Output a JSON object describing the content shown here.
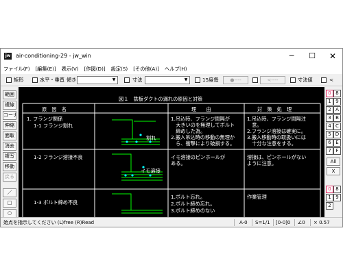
{
  "window": {
    "app_icon": "jw",
    "title": "air-conditioning-29 - jw_win",
    "controls": {
      "minimize": "─",
      "maximize": "☐",
      "close": "✕"
    }
  },
  "menu": [
    "ファイル(F)",
    "[編集(E)]",
    "表示(V)",
    "[作図(D)]",
    "設定(S)",
    "[その他(A)]",
    "ヘルプ(H)"
  ],
  "toolbar": {
    "rect_label": "矩形",
    "hv_label": "水平・垂直",
    "tilt_label": "傾き",
    "tilt_value": "",
    "dim_label": "寸法",
    "dim_value": "",
    "deg15_label": "15度毎",
    "btn_circle": "●----",
    "btn_arrow": "<----",
    "dimvalue_label": "寸法値",
    "lt_label": "<"
  },
  "left_tools": [
    "範囲",
    "複線",
    "コーナー",
    "伸縮",
    "面取",
    "消去",
    "複写",
    "移動",
    "戻る",
    "／",
    "□",
    "○"
  ],
  "right_panel": {
    "layers_top": [
      "0",
      "8",
      "1",
      "9",
      "2",
      "A",
      "3",
      "B",
      "4",
      "C",
      "5",
      "D",
      "6",
      "E",
      "7",
      "F"
    ],
    "all_label": "All",
    "ex_label": "X",
    "layers_bottom": [
      "0",
      "8",
      "1",
      "9",
      "2"
    ]
  },
  "drawing": {
    "figure_title": "図１　鉄板ダクトの漏れの原因と対策",
    "headers": [
      "原　因　名",
      "理　　由",
      "対　策　処　理"
    ],
    "rows": [
      {
        "cause_main": "1. フランジ関係",
        "cause_sub": "1-1 フランジ割れ",
        "diagram_label": "割れ",
        "reason": [
          "1.吊込時、フランジ間隔が",
          "　大きいのを無理してボルト",
          "　締めした為。",
          "2.搬入吊込時の移動の無理か",
          "　ら、衝撃により破損する。"
        ],
        "measure": [
          "1.吊込時、フランジ間隔注",
          "　意。",
          "2.フランジ溶接は確実に。",
          "3.搬入移動時の取扱いには",
          "　十分な注意をする。"
        ]
      },
      {
        "cause_sub": "1-2 フランジ溶接不良",
        "diagram_label": "イモ溶接",
        "reason": [
          "イモ溶接のピンホールが",
          "ある。"
        ],
        "measure": [
          "溶接は、ピンホールがない",
          "ように注意。"
        ]
      },
      {
        "cause_sub": "1-3 ボルト締め不良",
        "reason": [
          "1.ボルト忘れ。",
          "2.ボルト締め忘れ。",
          "3.ボルト締めのない"
        ],
        "measure": [
          "作業管理"
        ]
      }
    ]
  },
  "status": {
    "message": "始点を指示してください (L)free (R)Read",
    "layer": "A-0",
    "scale": "S=1/1",
    "group": "[0-0]0",
    "angle": "∠0",
    "zoom": "× 0.57"
  }
}
